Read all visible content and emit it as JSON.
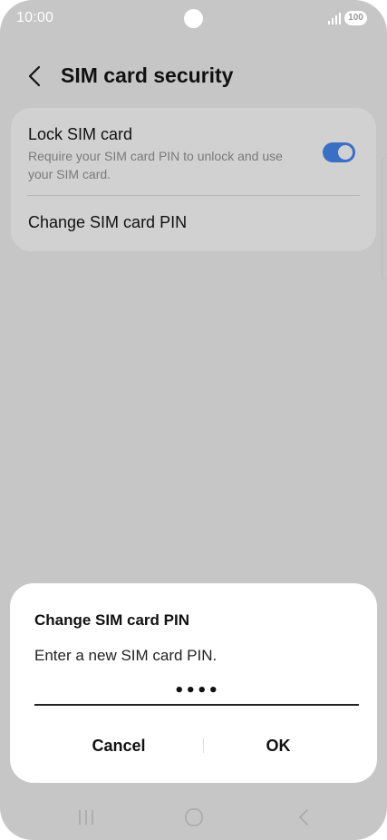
{
  "status_bar": {
    "time": "10:00",
    "battery": "100"
  },
  "header": {
    "title": "SIM card security"
  },
  "settings": {
    "lock_sim": {
      "title": "Lock SIM card",
      "description": "Require your SIM card PIN to unlock and use your SIM card.",
      "enabled": true
    },
    "change_pin": {
      "label": "Change SIM card PIN"
    }
  },
  "dialog": {
    "title": "Change SIM card PIN",
    "message": "Enter a new SIM card PIN.",
    "pin_value": "••••",
    "cancel_label": "Cancel",
    "ok_label": "OK"
  },
  "colors": {
    "toggle_on": "#3a6fc6",
    "scrim_background": "#c6c6c6",
    "card_background": "#d1d1d1"
  }
}
